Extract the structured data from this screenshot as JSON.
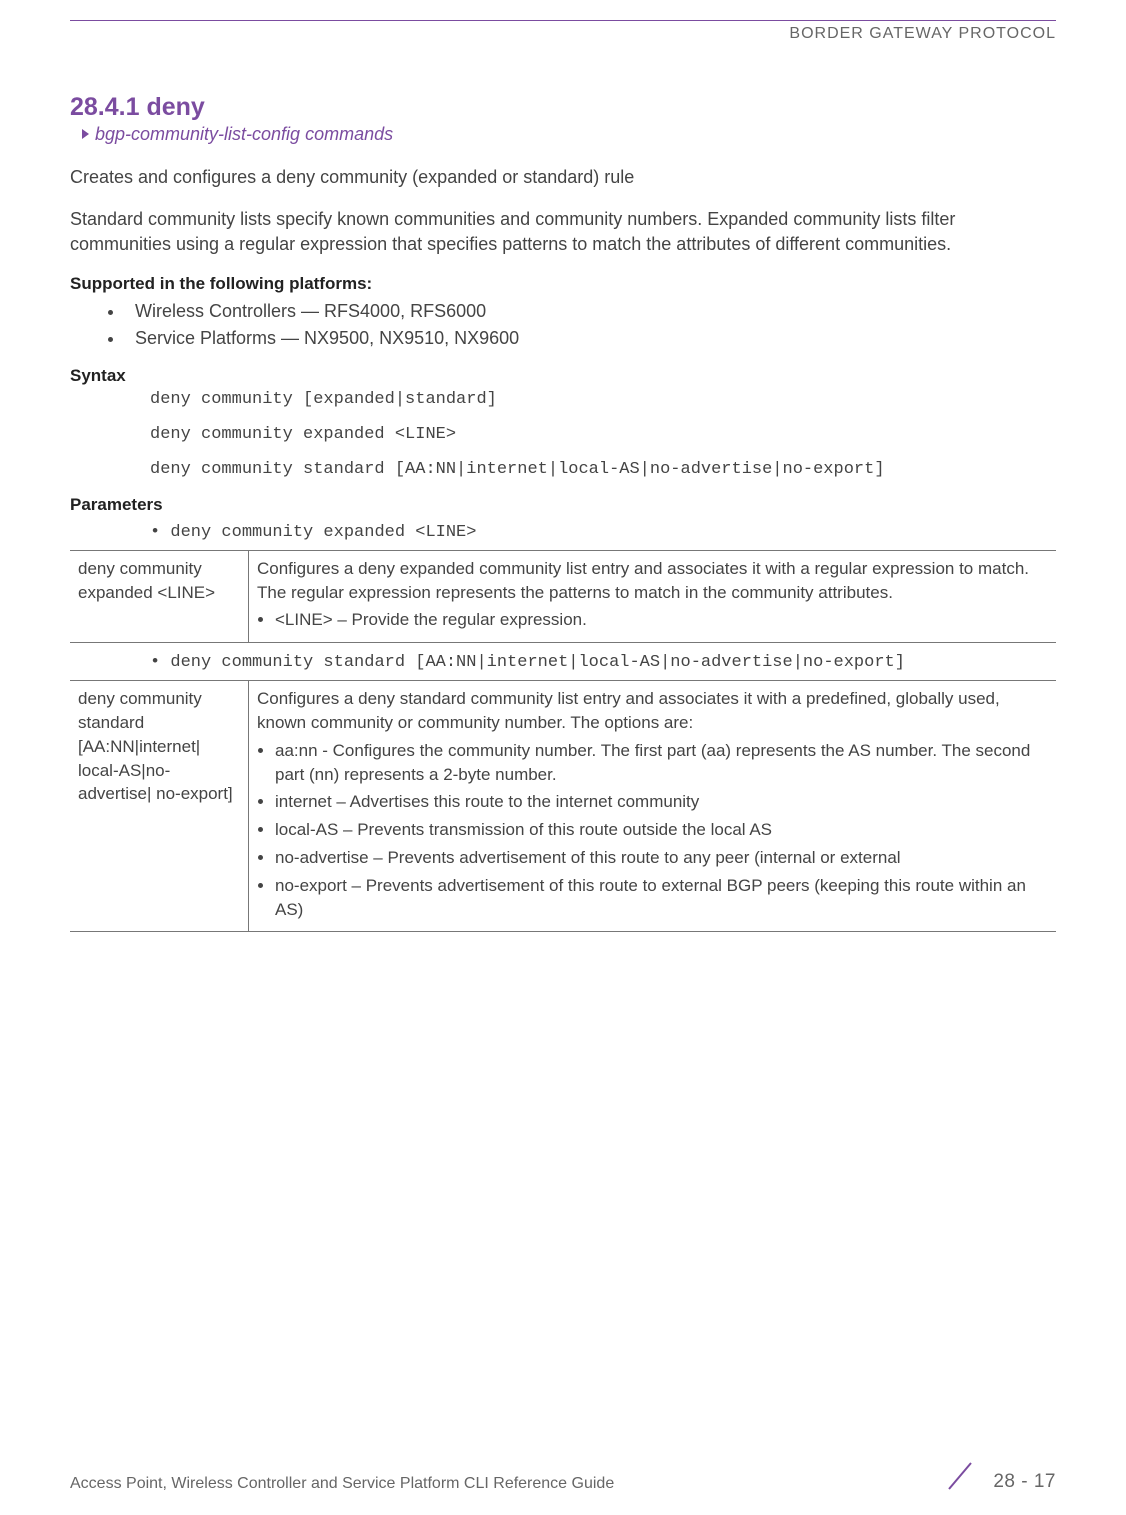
{
  "header": "BORDER GATEWAY PROTOCOL",
  "section_number_title": "28.4.1 deny",
  "breadcrumb": "bgp-community-list-config commands",
  "intro1": "Creates and configures a deny community (expanded or standard) rule",
  "intro2": "Standard community lists specify known communities and community numbers. Expanded community lists filter communities using a regular expression that specifies patterns to match the attributes of different communities.",
  "supported_heading": "Supported in the following platforms:",
  "platforms": [
    "Wireless Controllers — RFS4000, RFS6000",
    "Service Platforms — NX9500, NX9510, NX9600"
  ],
  "syntax_heading": "Syntax",
  "syntax_lines": [
    "deny community [expanded|standard]",
    "deny community expanded <LINE>",
    "deny community standard [AA:NN|internet|local-AS|no-advertise|no-export]"
  ],
  "parameters_heading": "Parameters",
  "param_bullet1": "deny community expanded <LINE>",
  "table1": {
    "left": "deny community expanded <LINE>",
    "right_p": "Configures a deny expanded community list entry and associates it with a regular expression to match. The regular expression represents the patterns to match in the community attributes.",
    "right_li1": "<LINE> – Provide the regular expression."
  },
  "param_bullet2": "deny community standard [AA:NN|internet|local-AS|no-advertise|no-export]",
  "table2": {
    "left": "deny community standard [AA:NN|internet| local-AS|no-advertise| no-export]",
    "right_p": "Configures a deny standard community list entry and associates it with a predefined, globally used, known community or community number. The options are:",
    "items": [
      "aa:nn - Configures the community number. The first part (aa) represents the AS number. The second part (nn) represents a 2-byte number.",
      "internet – Advertises this route to the internet community",
      "local-AS – Prevents transmission of this route outside the local AS",
      "no-advertise – Prevents advertisement of this route to any peer (internal or external",
      "no-export – Prevents advertisement of this route to external BGP peers (keeping this route within an AS)"
    ]
  },
  "footer_left": "Access Point, Wireless Controller and Service Platform CLI Reference Guide",
  "footer_right": "28 - 17"
}
